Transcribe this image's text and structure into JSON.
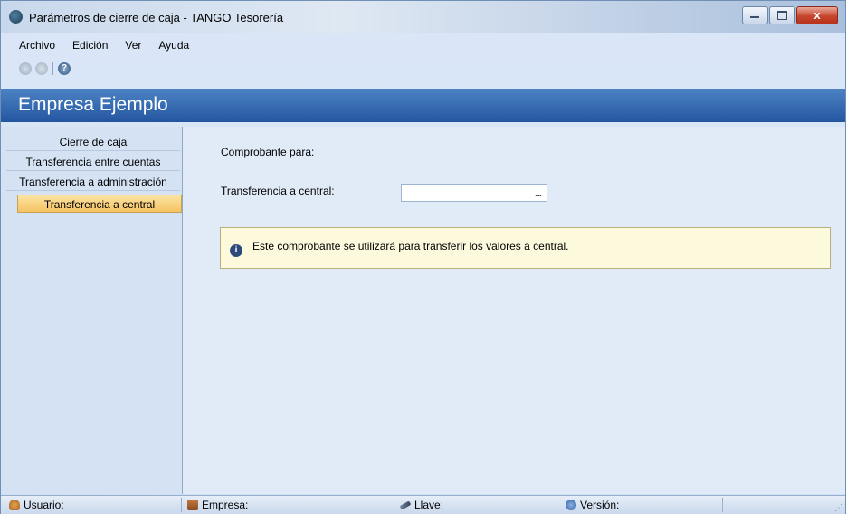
{
  "window": {
    "title": "Parámetros de cierre de caja - TANGO Tesorería",
    "close_glyph": "x"
  },
  "menu": {
    "items": [
      "Archivo",
      "Edición",
      "Ver",
      "Ayuda"
    ]
  },
  "toolbar": {
    "help_glyph": "?"
  },
  "header": {
    "company": "Empresa Ejemplo"
  },
  "sidebar": {
    "items": [
      {
        "label": "Cierre de caja",
        "active": false
      },
      {
        "label": "Transferencia entre cuentas",
        "active": false
      },
      {
        "label": "Transferencia a administración",
        "active": false
      },
      {
        "label": "Transferencia a central",
        "active": true
      }
    ]
  },
  "main": {
    "section_label": "Comprobante para:",
    "field_label": "Transferencia a central:",
    "field_value": "",
    "browse_label": "...",
    "info_icon": "i",
    "info_text": "Este comprobante se utilizará para transferir los valores a central."
  },
  "statusbar": {
    "usuario": "Usuario:",
    "empresa": "Empresa:",
    "llave": "Llave:",
    "version": "Versión:"
  }
}
